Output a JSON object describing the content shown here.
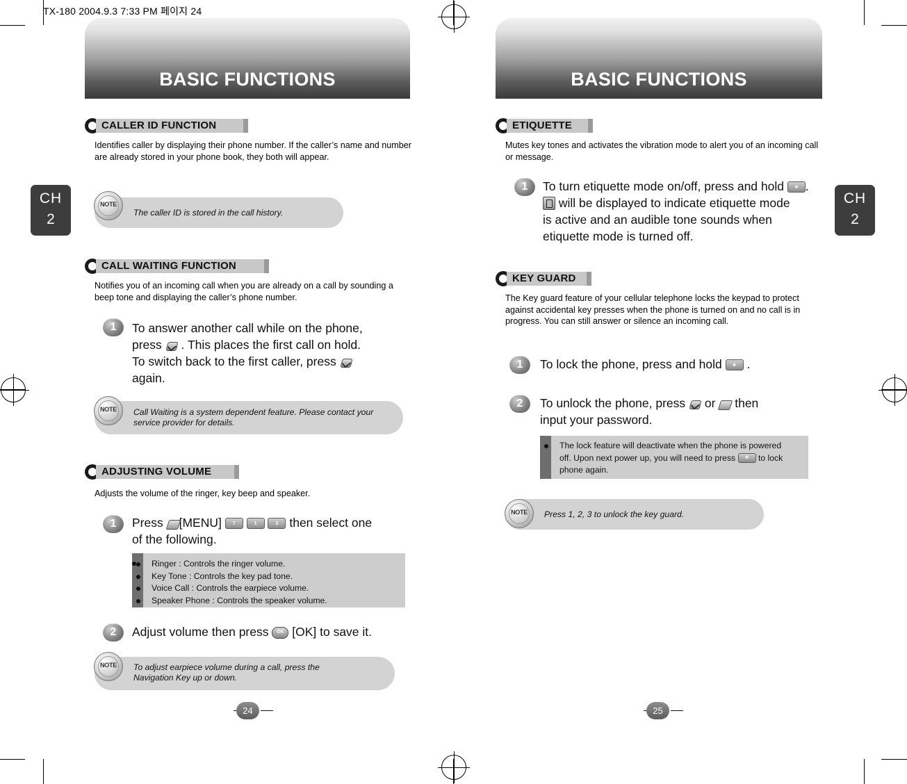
{
  "file_header": "TX-180  2004.9.3 7:33 PM  페이지 24",
  "left_page": {
    "banner_title": "BASIC FUNCTIONS",
    "ch_tab": {
      "line1": "CH",
      "line2": "2"
    },
    "page_number": "24",
    "sections": [
      {
        "heading": "CALLER ID FUNCTION",
        "intro": "Identifies caller by displaying their phone number.  If the caller’s name and number are already stored in your phone book, they both will appear.",
        "note": "The caller ID is stored in the call history."
      },
      {
        "heading": "CALL WAITING FUNCTION",
        "intro": "Notifies you of an incoming call when you are already on a call by sounding a beep tone and displaying the caller’s phone number.",
        "step1_num": "1",
        "step1_a": "To answer another call while on the phone,",
        "step1_b": "press",
        "step1_c": ". This places the first call on hold.",
        "step1_d": "To switch back to the first caller, press",
        "step1_e": "again.",
        "note": "Call Waiting is a system dependent feature. Please contact your service provider for details."
      },
      {
        "heading": "ADJUSTING VOLUME",
        "intro": "Adjusts the volume of the ringer, key beep and speaker.",
        "step1_num": "1",
        "step1_a": "Press",
        "step1_b": "[MENU]",
        "step1_c": "then select one",
        "step1_d": "of the following.",
        "options": [
          "Ringer : Controls the ringer volume.",
          "Key Tone : Controls the key pad tone.",
          "Voice Call : Controls the earpiece volume.",
          "Speaker Phone : Controls the speaker volume."
        ],
        "step2_num": "2",
        "step2_a": "Adjust volume then press",
        "step2_b": "[OK] to save it.",
        "note_line1": "To adjust earpiece volume during a call, press the",
        "note_line2": "Navigation Key up or down."
      }
    ]
  },
  "right_page": {
    "banner_title": "BASIC FUNCTIONS",
    "ch_tab": {
      "line1": "CH",
      "line2": "2"
    },
    "page_number": "25",
    "sections": [
      {
        "heading": "ETIQUETTE",
        "intro": "Mutes key tones and activates the vibration mode to alert you of an incoming call or message.",
        "step1_num": "1",
        "step1_a": "To turn etiquette mode on/off, press and hold",
        "step1_b": ".",
        "step1_c": "will be displayed to indicate etiquette mode",
        "step1_d": "is active and an audible tone sounds when",
        "step1_e": "etiquette mode is turned off."
      },
      {
        "heading": "KEY GUARD",
        "intro": "The Key guard feature of your cellular telephone locks the keypad to protect against accidental key presses when the phone is turned on and no call is in progress. You can still answer or silence an incoming call.",
        "step1_num": "1",
        "step1_a": "To lock the phone, press and hold",
        "step1_b": ".",
        "step2_num": "2",
        "step2_a": "To unlock the phone, press",
        "step2_b": "or",
        "step2_c": "then",
        "step2_d": "input your password.",
        "grey_box": {
          "line1": "The lock feature will deactivate when the phone is powered",
          "line2": "off. Upon next power up, you will need to press",
          "line2b": "to lock",
          "line3": "phone again."
        },
        "note": "Press 1, 2, 3 to unlock the key guard."
      }
    ]
  },
  "icons": {
    "send_key": "send-phone-key",
    "end_key": "end-phone-key",
    "menu_key": "menu-slant-key",
    "key7": "7",
    "key1": "1",
    "key2": "2",
    "ok_key": "OK",
    "star_key": "∗",
    "vibrate_icon": "vibrate-indicator"
  }
}
